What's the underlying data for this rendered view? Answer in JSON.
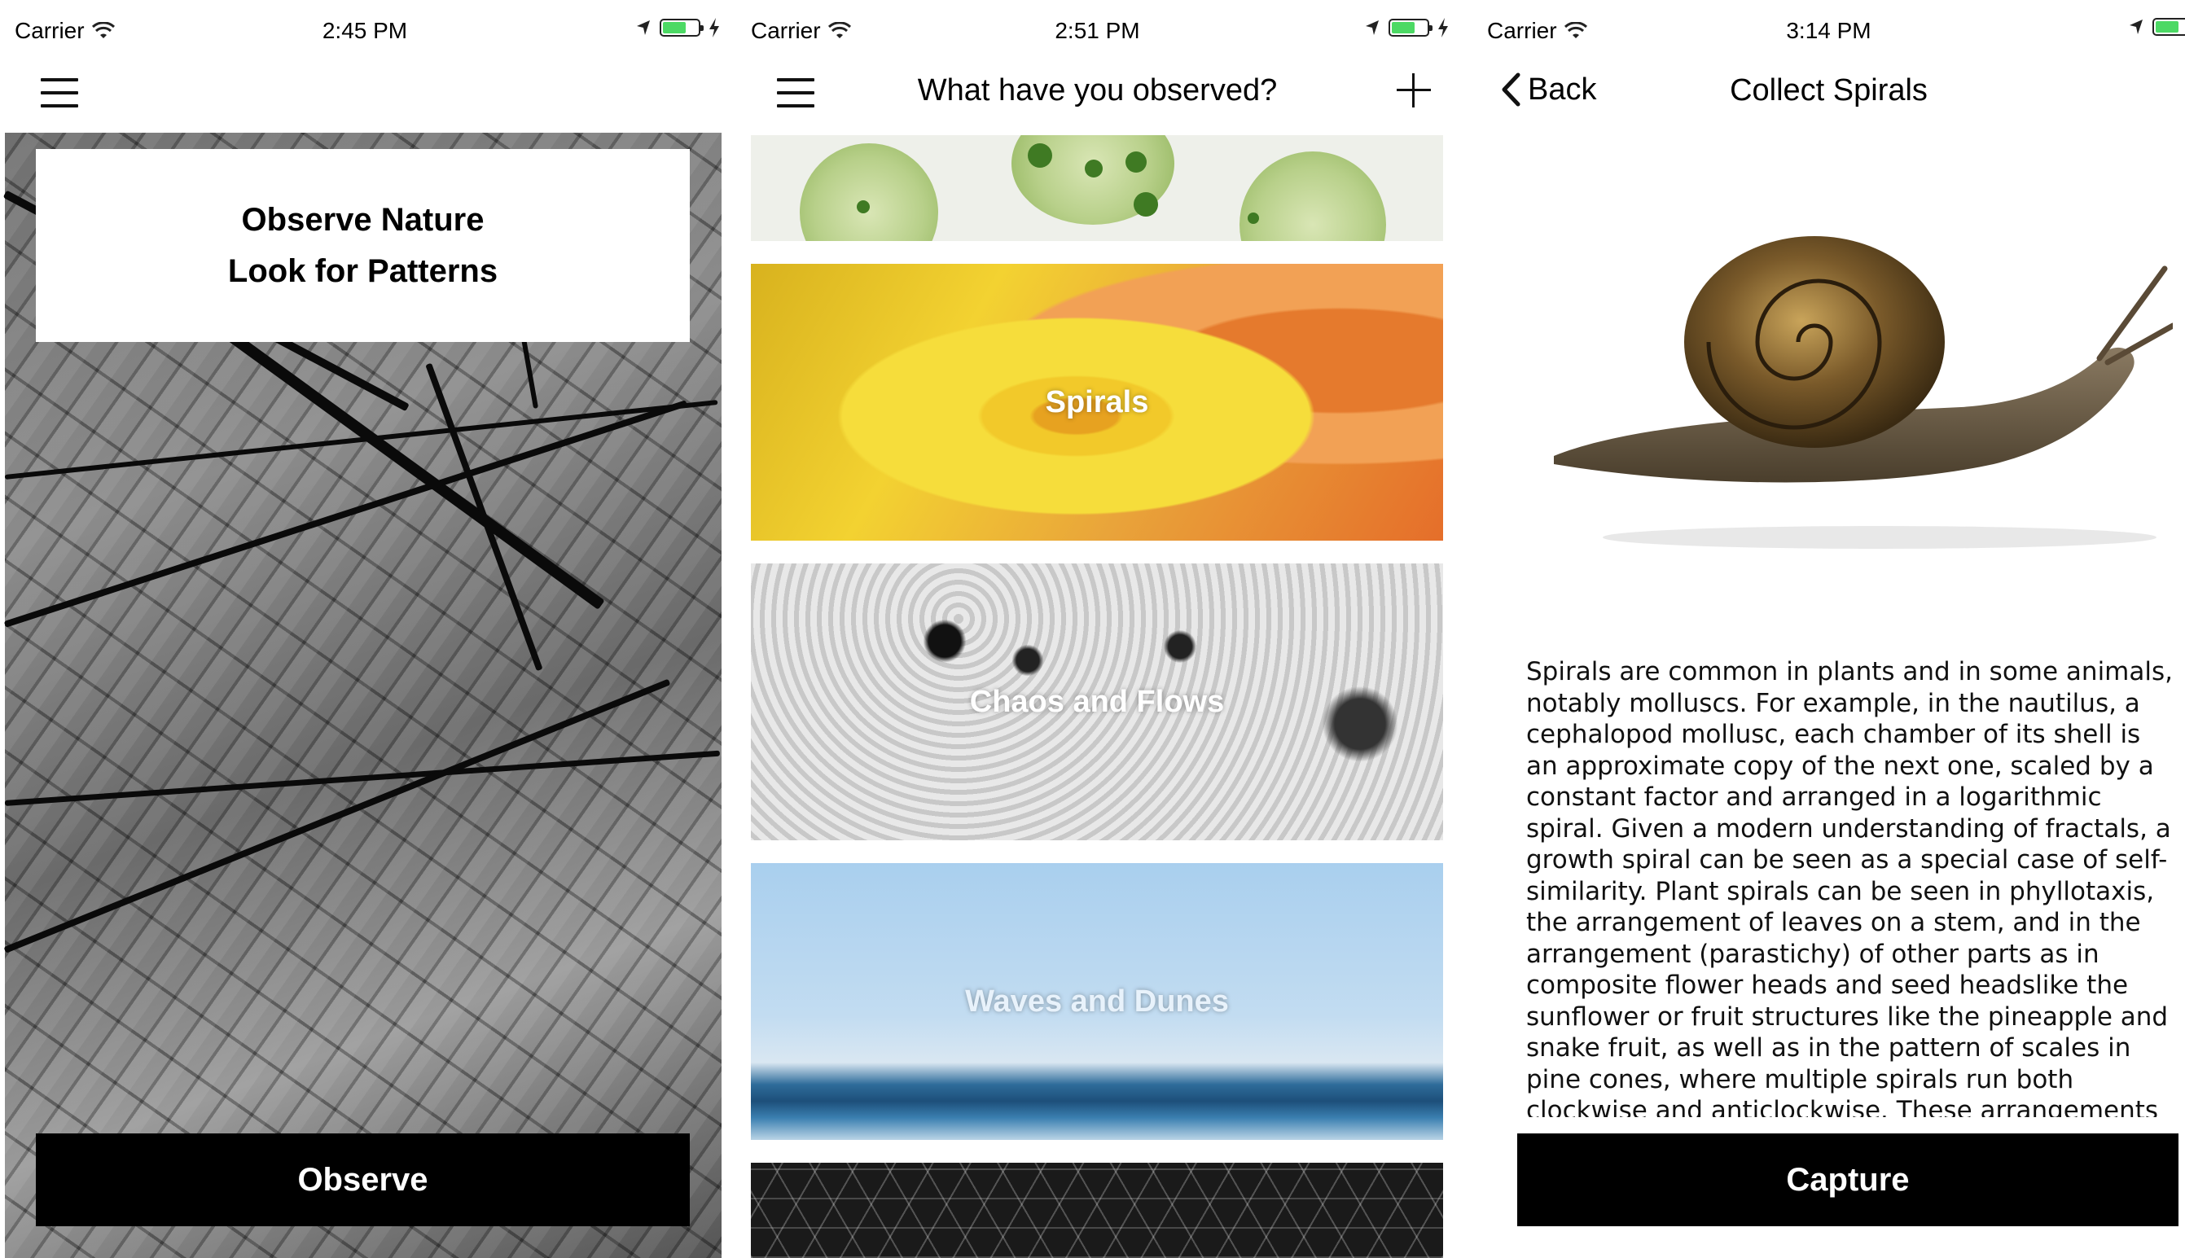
{
  "screens": [
    {
      "status": {
        "carrier": "Carrier",
        "time": "2:45 PM"
      },
      "intro": {
        "line1": "Observe Nature",
        "line2": "Look for Patterns"
      },
      "primary_button": "Observe",
      "icons": [
        "menu-icon",
        "wifi-icon",
        "location-arrow-icon",
        "battery-icon",
        "charging-bolt-icon"
      ]
    },
    {
      "status": {
        "carrier": "Carrier",
        "time": "2:51 PM"
      },
      "nav_title": "What have you observed?",
      "icons": [
        "menu-icon",
        "plus-icon"
      ],
      "cards": [
        {
          "label": ""
        },
        {
          "label": "Spirals"
        },
        {
          "label": "Chaos and Flows"
        },
        {
          "label": "Waves and Dunes"
        },
        {
          "label": ""
        }
      ]
    },
    {
      "status": {
        "carrier": "Carrier",
        "time": "3:14 PM"
      },
      "back_label": "Back",
      "nav_title": "Collect Spirals",
      "icons": [
        "back-chevron-icon"
      ],
      "description": "Spirals are common in plants and in some animals, notably molluscs. For example, in the nautilus, a cephalopod mollusc, each chamber of its shell is an approximate copy of the next one, scaled by a constant factor and arranged in a logarithmic spiral. Given a modern understanding of fractals, a growth spiral can be seen as a special case of self-similarity. Plant spirals can be seen in phyllotaxis, the arrangement of leaves on a stem, and in the arrangement (parastichy) of other parts as in composite flower heads and seed headslike the sunflower or fruit structures like the pineapple and snake fruit, as well as in the pattern of scales in pine cones, where multiple spirals run both clockwise and anticlockwise. These arrangements",
      "primary_button": "Capture"
    }
  ],
  "colors": {
    "button_bg": "#000000",
    "button_text": "#ffffff",
    "battery_green": "#4cd964"
  }
}
